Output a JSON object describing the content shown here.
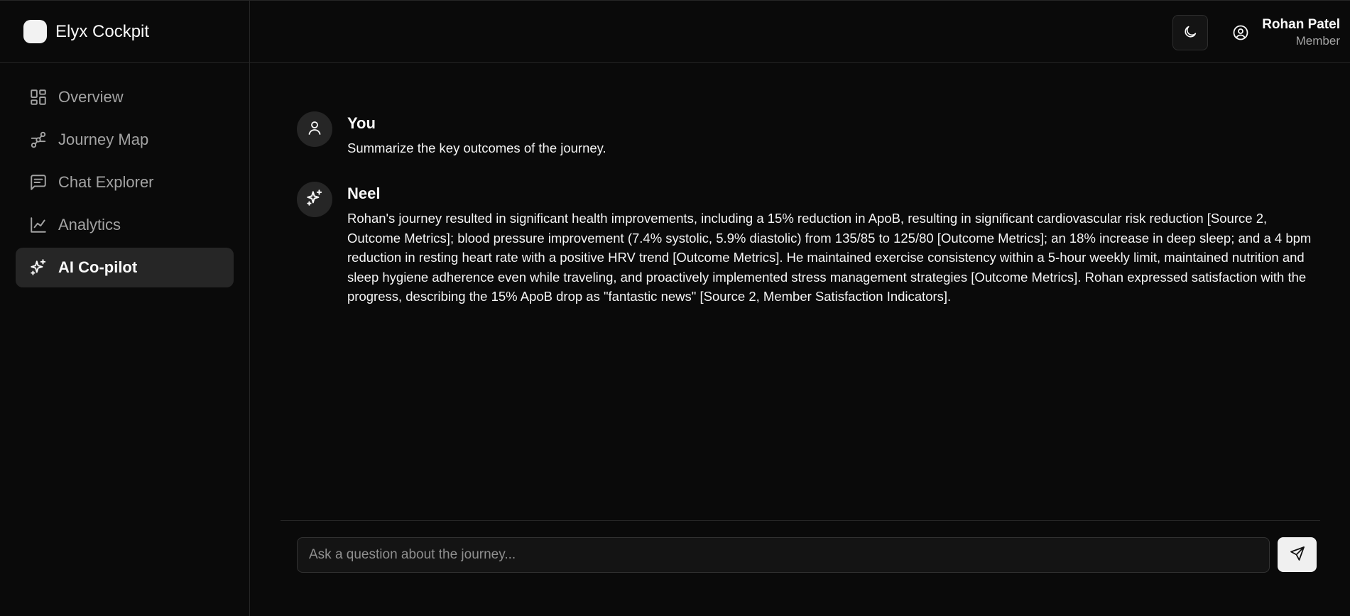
{
  "app": {
    "name": "Elyx Cockpit"
  },
  "sidebar": {
    "items": [
      {
        "label": "Overview",
        "icon": "layout-grid-icon",
        "active": false
      },
      {
        "label": "Journey Map",
        "icon": "route-icon",
        "active": false
      },
      {
        "label": "Chat Explorer",
        "icon": "message-square-text-icon",
        "active": false
      },
      {
        "label": "Analytics",
        "icon": "line-chart-icon",
        "active": false
      },
      {
        "label": "AI Co-pilot",
        "icon": "sparkles-icon",
        "active": true
      }
    ]
  },
  "header": {
    "theme_icon": "moon-icon",
    "user": {
      "name": "Rohan Patel",
      "role": "Member",
      "icon": "user-circle-icon"
    }
  },
  "chat": {
    "messages": [
      {
        "author": "You",
        "avatar_icon": "user-icon",
        "text": "Summarize the key outcomes of the journey."
      },
      {
        "author": "Neel",
        "avatar_icon": "sparkles-icon",
        "text": "Rohan's journey resulted in significant health improvements, including a 15% reduction in ApoB, resulting in significant cardiovascular risk reduction [Source 2, Outcome Metrics]; blood pressure improvement (7.4% systolic, 5.9% diastolic) from 135/85 to 125/80 [Outcome Metrics]; an 18% increase in deep sleep; and a 4 bpm reduction in resting heart rate with a positive HRV trend [Outcome Metrics]. He maintained exercise consistency within a 5-hour weekly limit, maintained nutrition and sleep hygiene adherence even while traveling, and proactively implemented stress management strategies [Outcome Metrics]. Rohan expressed satisfaction with the progress, describing the 15% ApoB drop as \"fantastic news\" [Source 2, Member Satisfaction Indicators]."
      }
    ]
  },
  "composer": {
    "placeholder": "Ask a question about the journey...",
    "value": "",
    "send_icon": "send-icon"
  },
  "colors": {
    "background": "#0a0a0a",
    "border": "#262626",
    "active_nav": "#262626",
    "muted_text": "#a3a3a3",
    "send_button": "#f0f0f0"
  }
}
